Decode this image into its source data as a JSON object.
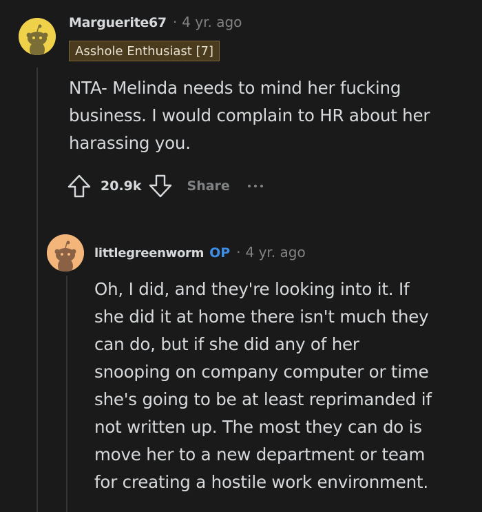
{
  "comment": {
    "username": "Marguerite67",
    "separator": "·",
    "time": "4 yr. ago",
    "flair": "Asshole Enthusiast [7]",
    "body": "NTA- Melinda needs to mind her fucking\nbusiness. I would complain to HR about her\nharassing you.",
    "votes": "20.9k",
    "share_label": "Share",
    "icons": {
      "upvote": "arrow-up-icon",
      "downvote": "arrow-down-icon",
      "more": "ellipsis-icon",
      "avatar": "snoo-avatar"
    },
    "avatar_bg": "#f0d24a"
  },
  "reply": {
    "username": "littlegreenworm",
    "op_badge": "OP",
    "separator": "·",
    "time": "4 yr. ago",
    "body": "Oh, I did, and they're looking into it. If\nshe did it at home there isn't much they\ncan do, but if she did any of her\nsnooping on company computer or time\nshe's going to be at least reprimanded if\nnot written up. The most they can do is\nmove her to a new department or team\nfor creating a hostile work environment.",
    "avatar_bg": "#f3b57a"
  },
  "colors": {
    "background": "#1a1a1b",
    "text": "#d7dadc",
    "muted": "#818384",
    "op_blue": "#3f8ee6",
    "flair_bg": "#4a3b1e"
  }
}
